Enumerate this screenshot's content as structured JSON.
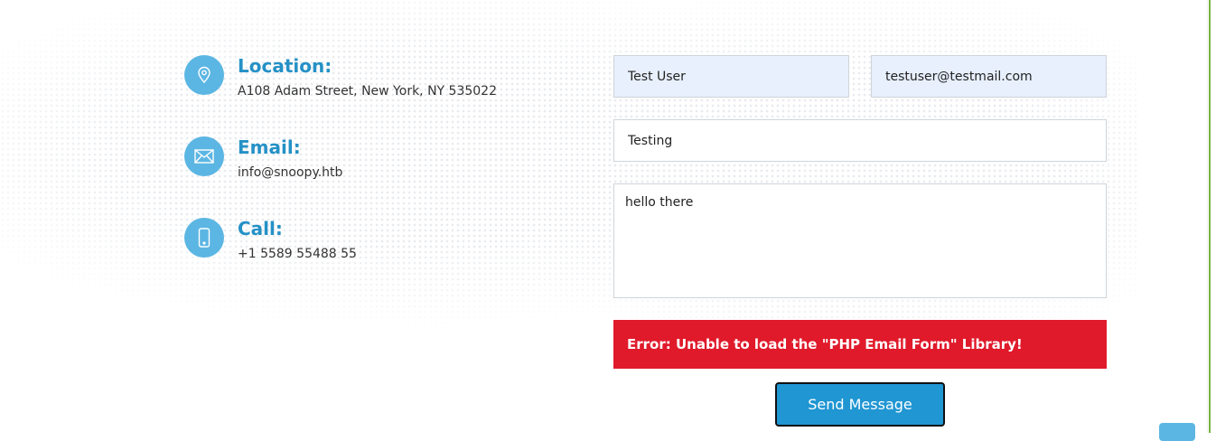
{
  "contact_info": {
    "location": {
      "title": "Location:",
      "text": "A108 Adam Street, New York, NY 535022",
      "icon": "map-pin-icon"
    },
    "email": {
      "title": "Email:",
      "text": "info@snoopy.htb",
      "icon": "envelope-icon"
    },
    "call": {
      "title": "Call:",
      "text": "+1 5589 55488 55",
      "icon": "phone-icon"
    }
  },
  "form": {
    "name_value": "Test User",
    "email_value": "testuser@testmail.com",
    "subject_value": "Testing",
    "message_value": "hello there",
    "error_message": "Error: Unable to load the \"PHP Email Form\" Library!",
    "submit_label": "Send Message"
  },
  "colors": {
    "accent": "#2591c6",
    "icon_bg": "#5cb6e3",
    "error_bg": "#e01a2b",
    "button_bg": "#2096d3"
  }
}
